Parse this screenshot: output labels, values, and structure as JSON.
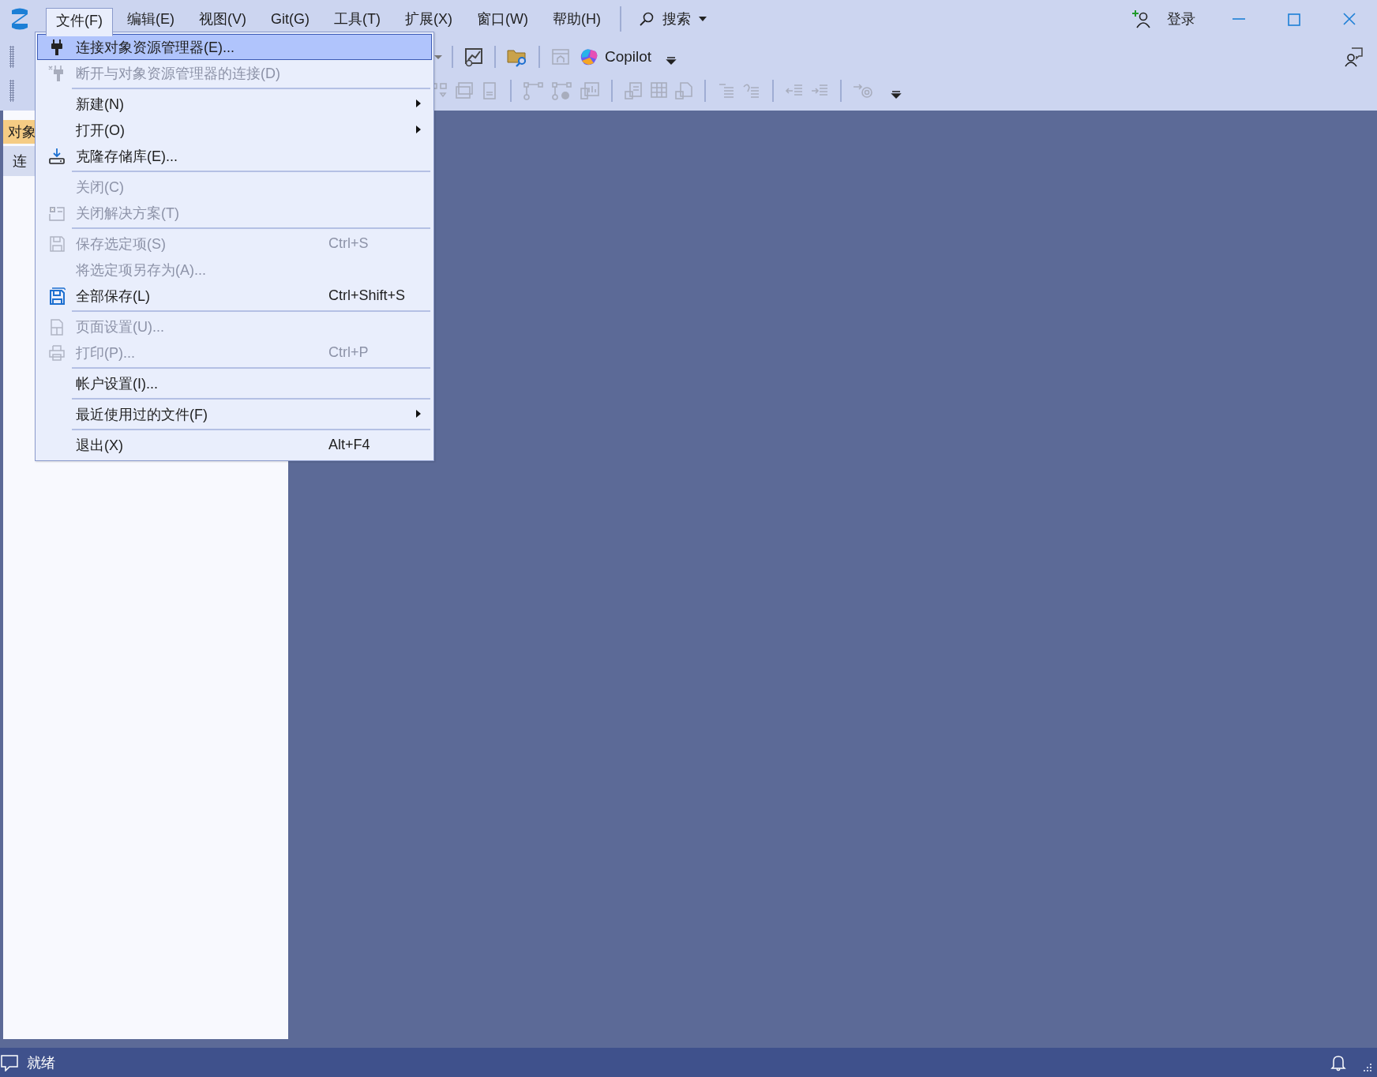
{
  "menu_bar": [
    {
      "label": "文件(F)",
      "selected": true
    },
    {
      "label": "编辑(E)",
      "selected": false
    },
    {
      "label": "视图(V)",
      "selected": false
    },
    {
      "label": "Git(G)",
      "selected": false
    },
    {
      "label": "工具(T)",
      "selected": false
    },
    {
      "label": "扩展(X)",
      "selected": false
    },
    {
      "label": "窗口(W)",
      "selected": false
    },
    {
      "label": "帮助(H)",
      "selected": false
    }
  ],
  "search": {
    "label": "搜索"
  },
  "account": {
    "label": "登录"
  },
  "toolbar": {
    "copilot_label": "Copilot"
  },
  "side_panel": {
    "tab": "对象",
    "row": "连"
  },
  "file_menu": [
    {
      "kind": "item",
      "label": "连接对象资源管理器(E)...",
      "disabled": false,
      "selected": true,
      "submenu": false
    },
    {
      "kind": "item",
      "label": "断开与对象资源管理器的连接(D)",
      "disabled": true,
      "selected": false,
      "submenu": false
    },
    {
      "kind": "separator"
    },
    {
      "kind": "item",
      "label": "新建(N)",
      "disabled": false,
      "selected": false,
      "submenu": true
    },
    {
      "kind": "item",
      "label": "打开(O)",
      "disabled": false,
      "selected": false,
      "submenu": true
    },
    {
      "kind": "item",
      "label": "克隆存储库(E)...",
      "disabled": false,
      "selected": false,
      "submenu": false
    },
    {
      "kind": "separator"
    },
    {
      "kind": "item",
      "label": "关闭(C)",
      "disabled": true,
      "selected": false,
      "submenu": false
    },
    {
      "kind": "item",
      "label": "关闭解决方案(T)",
      "disabled": true,
      "selected": false,
      "submenu": false
    },
    {
      "kind": "separator"
    },
    {
      "kind": "item",
      "label": "保存选定项(S)",
      "shortcut": "Ctrl+S",
      "disabled": true,
      "selected": false,
      "submenu": false
    },
    {
      "kind": "item",
      "label": "将选定项另存为(A)...",
      "disabled": true,
      "selected": false,
      "submenu": false
    },
    {
      "kind": "item",
      "label": "全部保存(L)",
      "shortcut": "Ctrl+Shift+S",
      "disabled": false,
      "selected": false,
      "submenu": false
    },
    {
      "kind": "separator"
    },
    {
      "kind": "item",
      "label": "页面设置(U)...",
      "disabled": true,
      "selected": false,
      "submenu": false
    },
    {
      "kind": "item",
      "label": "打印(P)...",
      "shortcut": "Ctrl+P",
      "disabled": true,
      "selected": false,
      "submenu": false
    },
    {
      "kind": "separator"
    },
    {
      "kind": "item",
      "label": "帐户设置(I)...",
      "disabled": false,
      "selected": false,
      "submenu": false
    },
    {
      "kind": "separator"
    },
    {
      "kind": "item",
      "label": "最近使用过的文件(F)",
      "disabled": false,
      "selected": false,
      "submenu": true
    },
    {
      "kind": "separator"
    },
    {
      "kind": "item",
      "label": "退出(X)",
      "shortcut": "Alt+F4",
      "disabled": false,
      "selected": false,
      "submenu": false
    }
  ],
  "status_bar": {
    "text": "就绪"
  }
}
